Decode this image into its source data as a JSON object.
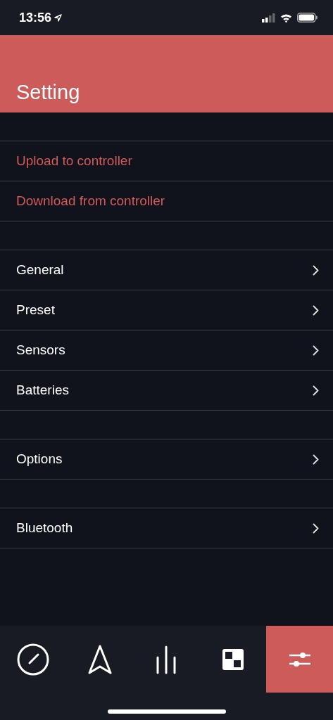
{
  "status_bar": {
    "time": "13:56"
  },
  "header": {
    "title": "Setting"
  },
  "sections": [
    {
      "items": [
        {
          "label": "Upload to controller",
          "kind": "action"
        },
        {
          "label": "Download from controller",
          "kind": "action"
        }
      ]
    },
    {
      "items": [
        {
          "label": "General",
          "kind": "link"
        },
        {
          "label": "Preset",
          "kind": "link"
        },
        {
          "label": "Sensors",
          "kind": "link"
        },
        {
          "label": "Batteries",
          "kind": "link"
        }
      ]
    },
    {
      "items": [
        {
          "label": "Options",
          "kind": "link"
        }
      ]
    },
    {
      "items": [
        {
          "label": "Bluetooth",
          "kind": "link"
        }
      ]
    }
  ],
  "tabs": [
    {
      "kind": "gauge",
      "selected": false
    },
    {
      "kind": "navigation",
      "selected": false
    },
    {
      "kind": "bars",
      "selected": false
    },
    {
      "kind": "squares",
      "selected": false
    },
    {
      "kind": "sliders",
      "selected": true
    }
  ]
}
